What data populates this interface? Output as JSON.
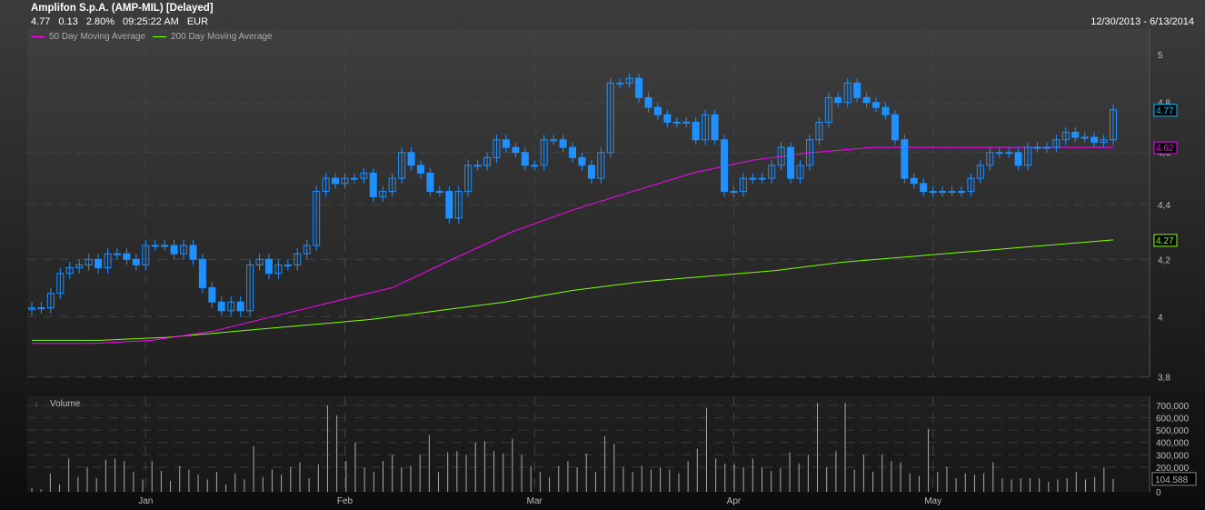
{
  "header": {
    "title": "Amplifon S.p.A. (AMP-MIL) [Delayed]",
    "last": "4.77",
    "change": "0.13",
    "change_pct": "2.80%",
    "time": "09:25:22 AM",
    "currency": "EUR",
    "date_range": "12/30/2013 - 6/13/2014"
  },
  "legend": [
    {
      "label": "50 Day Moving Average",
      "color": "#ff00ff"
    },
    {
      "label": "200 Day Moving Average",
      "color": "#80ff00"
    }
  ],
  "colors": {
    "candle": "#1e90ff",
    "price_tag": "#00bfff"
  },
  "chart_data": {
    "type": "candlestick",
    "title": "Amplifon S.p.A. (AMP-MIL) [Delayed]",
    "ylim": [
      3.8,
      5.05
    ],
    "y_ticks": [
      "5",
      "4,8",
      "4,6",
      "4,4",
      "4,2",
      "4",
      "3,8"
    ],
    "y_tick_values": [
      5,
      4.8,
      4.6,
      4.4,
      4.2,
      4,
      3.8
    ],
    "x_ticks": [
      {
        "label": "Jan",
        "index": 12
      },
      {
        "label": "Feb",
        "index": 33
      },
      {
        "label": "Mar",
        "index": 53
      },
      {
        "label": "Apr",
        "index": 74
      },
      {
        "label": "May",
        "index": 95
      }
    ],
    "closes": [
      4.03,
      4.03,
      4.08,
      4.15,
      4.17,
      4.18,
      4.2,
      4.17,
      4.22,
      4.22,
      4.2,
      4.18,
      4.25,
      4.25,
      4.25,
      4.22,
      4.25,
      4.2,
      4.1,
      4.05,
      4.02,
      4.05,
      4.02,
      4.18,
      4.2,
      4.15,
      4.18,
      4.18,
      4.22,
      4.25,
      4.45,
      4.5,
      4.48,
      4.5,
      4.5,
      4.52,
      4.43,
      4.45,
      4.5,
      4.6,
      4.55,
      4.52,
      4.45,
      4.45,
      4.35,
      4.45,
      4.55,
      4.55,
      4.58,
      4.65,
      4.62,
      4.6,
      4.55,
      4.55,
      4.65,
      4.65,
      4.62,
      4.58,
      4.55,
      4.5,
      4.6,
      4.88,
      4.88,
      4.9,
      4.82,
      4.78,
      4.75,
      4.72,
      4.72,
      4.72,
      4.65,
      4.75,
      4.65,
      4.45,
      4.45,
      4.5,
      4.5,
      4.5,
      4.55,
      4.62,
      4.5,
      4.55,
      4.65,
      4.72,
      4.82,
      4.8,
      4.88,
      4.82,
      4.8,
      4.78,
      4.75,
      4.65,
      4.5,
      4.48,
      4.45,
      4.45,
      4.45,
      4.45,
      4.45,
      4.5,
      4.55,
      4.6,
      4.6,
      4.6,
      4.55,
      4.62,
      4.62,
      4.62,
      4.65,
      4.68,
      4.66,
      4.66,
      4.64,
      4.65,
      4.77
    ],
    "ma50": [
      3.91,
      3.91,
      3.92,
      3.95,
      4.0,
      4.05,
      4.1,
      4.2,
      4.3,
      4.38,
      4.45,
      4.52,
      4.57,
      4.6,
      4.62,
      4.62,
      4.62,
      4.62,
      4.62
    ],
    "ma200": [
      3.92,
      3.92,
      3.93,
      3.95,
      3.97,
      3.99,
      4.02,
      4.05,
      4.09,
      4.12,
      4.14,
      4.16,
      4.19,
      4.21,
      4.23,
      4.25,
      4.27
    ],
    "last_labels": {
      "price": "4.77",
      "ma50": "4.62",
      "ma200": "4.27"
    },
    "volume": {
      "label": "Volume",
      "y_ticks": [
        "700,000",
        "600,000",
        "500,000",
        "400,000",
        "300,000",
        "200,000",
        "0"
      ],
      "y_tick_values": [
        700000,
        600000,
        500000,
        400000,
        300000,
        200000,
        0
      ],
      "last": "104.588",
      "values": [
        30,
        20,
        150,
        60,
        270,
        120,
        200,
        110,
        260,
        270,
        250,
        160,
        100,
        250,
        170,
        90,
        210,
        180,
        140,
        100,
        160,
        60,
        150,
        100,
        370,
        120,
        180,
        140,
        200,
        240,
        110,
        220,
        700,
        620,
        250,
        400,
        200,
        160,
        250,
        300,
        200,
        210,
        300,
        460,
        160,
        320,
        330,
        300,
        400,
        410,
        330,
        310,
        430,
        300,
        210,
        160,
        120,
        210,
        250,
        200,
        310,
        160,
        450,
        390,
        200,
        160,
        210,
        180,
        200,
        180,
        150,
        250,
        350,
        680,
        270,
        230,
        220,
        200,
        270,
        200,
        170,
        190,
        320,
        230,
        300,
        720,
        200,
        330,
        720,
        180,
        300,
        160,
        300,
        250,
        240,
        150,
        130,
        510,
        160,
        200,
        110,
        150,
        140,
        150,
        240,
        110,
        100,
        110,
        110,
        110,
        80,
        100,
        110,
        160,
        100,
        120,
        200,
        104.588
      ]
    }
  }
}
